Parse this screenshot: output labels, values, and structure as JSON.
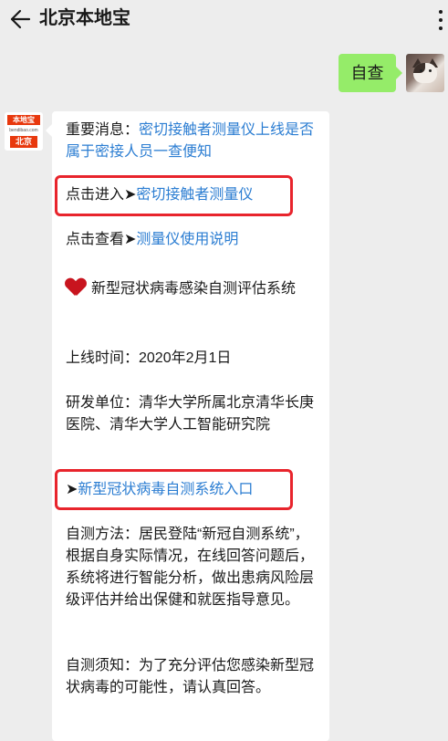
{
  "header": {
    "title": "北京本地宝"
  },
  "outgoing": {
    "text": "自查"
  },
  "sender": {
    "logo_top": "本地宝",
    "logo_mid": "bendibao.com",
    "logo_bottom": "北京"
  },
  "message": {
    "p1_label": "重要消息：",
    "p1_link": "密切接触者测量仪上线是否属于密接人员一查便知",
    "p2_label": "点击进入➤",
    "p2_link": "密切接触者测量仪",
    "p3_label": "点击查看➤",
    "p3_link": "测量仪使用说明",
    "p4_heading": "新型冠状病毒感染自测评估系统",
    "p5": "上线时间：2020年2月1日",
    "p6": "研发单位：清华大学所属北京清华长庚医院、清华大学人工智能研究院",
    "p7_arrow": "➤",
    "p7_link": "新型冠状病毒自测系统入口",
    "p8": "自测方法：居民登陆“新冠自测系统”，根据自身实际情况，在线回答问题后，系统将进行智能分析，做出患病风险层级评估并给出保健和就医指导意见。",
    "p9": "自测须知：为了充分评估您感染新型冠状病毒的可能性，请认真回答。"
  },
  "colors": {
    "link": "#2b7dd2",
    "highlight_box": "#e8242c",
    "outgoing_bubble": "#95ec69",
    "background": "#ededed"
  }
}
